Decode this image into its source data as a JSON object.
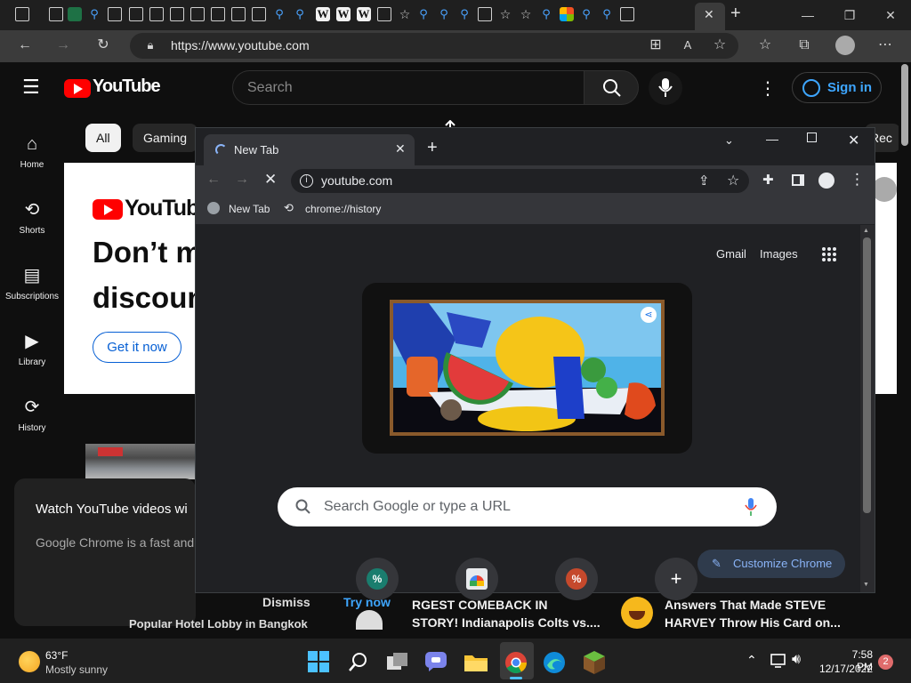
{
  "edge": {
    "url": "https://www.youtube.com",
    "tab_close_glyph": "✕",
    "new_tab_glyph": "+",
    "minimize_glyph": "—",
    "restore_glyph": "❐",
    "close_glyph": "✕",
    "tab_icons": [
      "tab-actions-icon",
      "page-icon",
      "excel-icon",
      "search-icon",
      "page-icon",
      "page-icon",
      "page-icon",
      "page-icon",
      "page-icon",
      "page-icon",
      "page-icon",
      "page-icon",
      "search-icon",
      "search-icon",
      "wikipedia-icon",
      "wikipedia-icon",
      "wikipedia-icon",
      "page-icon",
      "favorite-icon",
      "search-icon",
      "search-icon",
      "search-icon",
      "film-icon",
      "favorite-icon",
      "favorite-icon",
      "search-icon",
      "microsoft-icon",
      "search-icon",
      "search-icon",
      "film-icon"
    ]
  },
  "youtube": {
    "logo_text": "YouTube",
    "search_placeholder": "Search",
    "sign_in": "Sign in",
    "chips": [
      "All",
      "Gaming",
      "Rec"
    ],
    "sidebar": [
      {
        "label": "Home",
        "icon": "home-icon"
      },
      {
        "label": "Shorts",
        "icon": "shorts-icon"
      },
      {
        "label": "Subscriptions",
        "icon": "subscriptions-icon"
      },
      {
        "label": "Library",
        "icon": "library-icon"
      },
      {
        "label": "History",
        "icon": "history-icon"
      }
    ],
    "banner": {
      "logo_text": "YouTube",
      "headline_1": "Don’t m",
      "headline_2": "discoun",
      "cta": "Get it now"
    },
    "toast": {
      "title": "Watch YouTube videos wi",
      "body": "Google Chrome is a fast and",
      "dismiss": "Dismiss",
      "try_now": "Try now"
    },
    "videos": [
      {
        "title_1": "RGEST COMEBACK IN",
        "title_2": "STORY! Indianapolis Colts vs...."
      },
      {
        "title_1": "Answers That Made STEVE",
        "title_2": "HARVEY Throw His Card on..."
      }
    ],
    "partial_title": "Popular Hotel Lobby in Bangkok"
  },
  "chrome": {
    "tab_title": "New Tab",
    "url": "youtube.com",
    "bookmarks": [
      {
        "label": "New Tab",
        "icon": "globe-icon"
      },
      {
        "label": "chrome://history",
        "icon": "history-icon"
      }
    ],
    "gmail": "Gmail",
    "images": "Images",
    "search_placeholder": "Search Google or type a URL",
    "customize": "Customize Chrome",
    "shortcuts": [
      {
        "badge": "%",
        "color": "#1a7d6e"
      },
      {
        "badge": "",
        "color": "#e8eaed"
      },
      {
        "badge": "%",
        "color": "#c5492c"
      },
      {
        "badge": "+",
        "color": "#35363a"
      }
    ]
  },
  "taskbar": {
    "temperature": "63°F",
    "weather": "Mostly sunny",
    "time": "7:58 PM",
    "date": "12/17/2022",
    "notifications": "2"
  }
}
